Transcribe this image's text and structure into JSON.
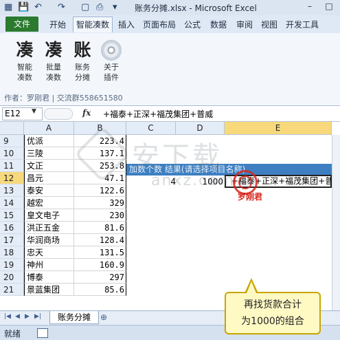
{
  "titlebar": {
    "title": "账务分摊.xlsx - Microsoft Excel",
    "minimize": "–",
    "maximize": "□"
  },
  "tabs": [
    "文件",
    "开始",
    "智能凑数",
    "插入",
    "页面布局",
    "公式",
    "数据",
    "审阅",
    "视图",
    "开发工具"
  ],
  "ribbon": {
    "items": [
      {
        "icon": "凑",
        "label1": "智能",
        "label2": "凑数"
      },
      {
        "icon": "凑",
        "label1": "批量",
        "label2": "凑数"
      },
      {
        "icon": "账",
        "label1": "账务",
        "label2": "分摊"
      },
      {
        "icon": "cd-icon",
        "label1": "关于",
        "label2": "插件"
      }
    ],
    "author": "作者：罗刚君 | 交流群558651580"
  },
  "formula_bar": {
    "namebox": "E12",
    "fx": "fx",
    "formula": "+福泰+正深+福茂集团+普威"
  },
  "columns": [
    "A",
    "B",
    "C",
    "D",
    "E"
  ],
  "rows": [
    {
      "num": "9",
      "a": "优派",
      "b": "223.4"
    },
    {
      "num": "10",
      "a": "三陵",
      "b": "137.1"
    },
    {
      "num": "11",
      "a": "文正",
      "b": "253.8"
    },
    {
      "num": "12",
      "a": "昌元",
      "b": "47.1"
    },
    {
      "num": "13",
      "a": "泰安",
      "b": "122.6"
    },
    {
      "num": "14",
      "a": "越宏",
      "b": "329"
    },
    {
      "num": "15",
      "a": "皇文电子",
      "b": "230"
    },
    {
      "num": "16",
      "a": "洪正五金",
      "b": "81.6"
    },
    {
      "num": "17",
      "a": "华润商场",
      "b": "128.4"
    },
    {
      "num": "18",
      "a": "忠天",
      "b": "131.5"
    },
    {
      "num": "19",
      "a": "神州",
      "b": "160.9"
    },
    {
      "num": "20",
      "a": "博泰",
      "b": "297"
    },
    {
      "num": "21",
      "a": "景蓝集团",
      "b": "85.6"
    }
  ],
  "result_header": "加数个数  结果(请选择项目名称)",
  "row12": {
    "c": "4",
    "d": "1000",
    "e": "+福泰+正深+福茂集团+普威"
  },
  "stamp_text": "罗刚君",
  "watermark": {
    "main": "安下载",
    "sub": "anxz.com"
  },
  "sheet": {
    "tab": "账务分摊"
  },
  "status": "就绪",
  "callout": {
    "line1": "再找货款合计",
    "line2": "为1000的组合"
  }
}
